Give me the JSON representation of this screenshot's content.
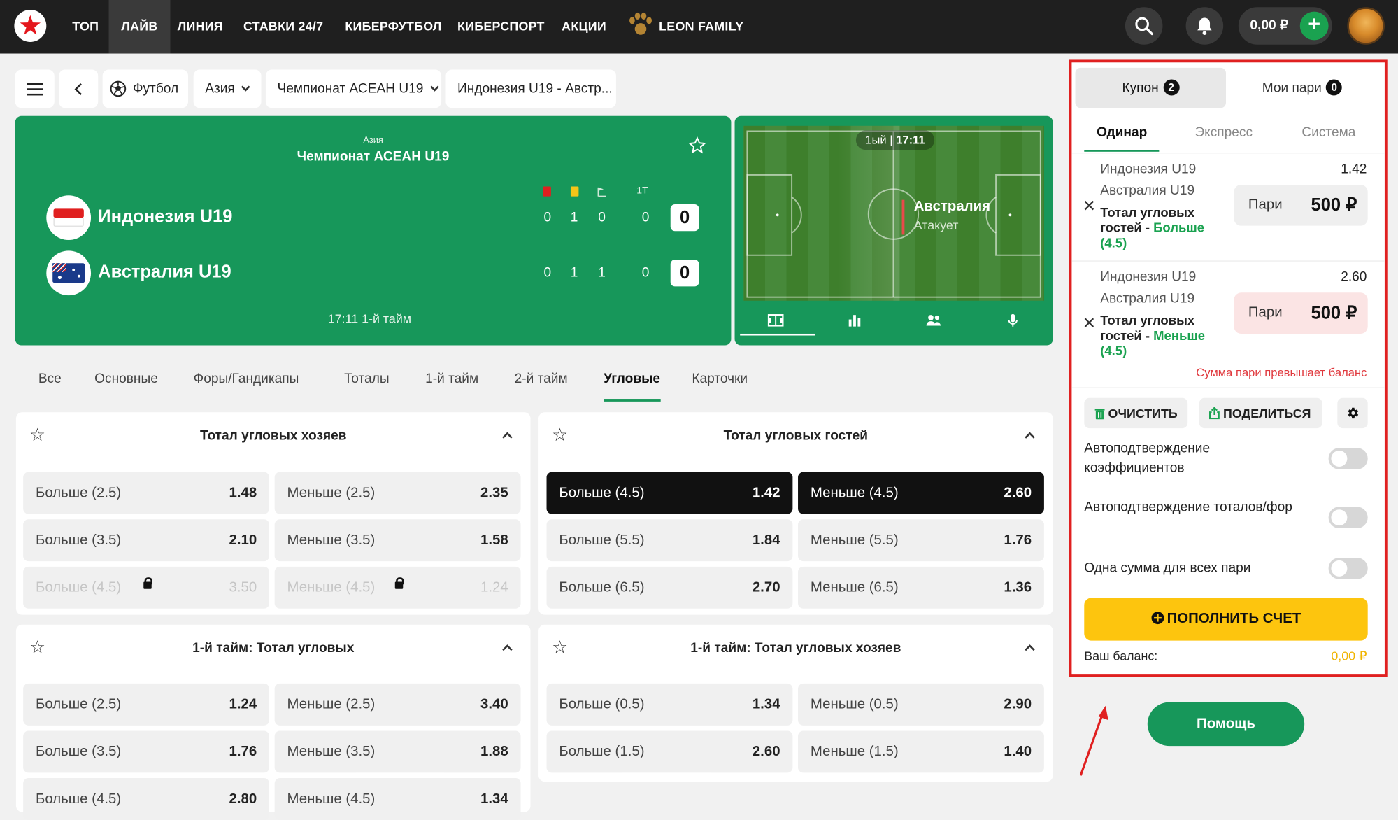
{
  "nav": {
    "items": [
      "ТОП",
      "ЛАЙВ",
      "ЛИНИЯ",
      "СТАВКИ 24/7",
      "КИБЕРФУТБОЛ",
      "КИБЕРСПОРТ",
      "АКЦИИ",
      "LEON FAMILY"
    ],
    "active": "ЛАЙВ",
    "balance": "0,00 ₽",
    "plus": "+"
  },
  "breadcrumb": {
    "sport": "Футбол",
    "region": "Азия",
    "league": "Чемпионат АСЕАН U19",
    "match": "Индонезия U19 - Австр..."
  },
  "match": {
    "region": "Азия",
    "league": "Чемпионат АСЕАН U19",
    "stat_header_1t": "1Т",
    "home": {
      "name": "Индонезия U19",
      "red": "0",
      "yellow": "1",
      "corners": "0",
      "first_half": "0",
      "score": "0"
    },
    "away": {
      "name": "Австралия U19",
      "red": "0",
      "yellow": "1",
      "corners": "1",
      "first_half": "0",
      "score": "0"
    },
    "time": "17:11 1-й тайм"
  },
  "field": {
    "period": "1ый",
    "clock": "17:11",
    "team": "Австралия",
    "action": "Атакует"
  },
  "market_tabs": [
    "Все",
    "Основные",
    "Форы/Гандикапы",
    "Тоталы",
    "1-й тайм",
    "2-й тайм",
    "Угловые",
    "Карточки"
  ],
  "active_market_tab": "Угловые",
  "markets": [
    {
      "title": "Тотал угловых хозяев",
      "rows": [
        [
          {
            "label": "Больше (2.5)",
            "odd": "1.48"
          },
          {
            "label": "Меньше (2.5)",
            "odd": "2.35"
          }
        ],
        [
          {
            "label": "Больше (3.5)",
            "odd": "2.10"
          },
          {
            "label": "Меньше (3.5)",
            "odd": "1.58"
          }
        ],
        [
          {
            "label": "Больше (4.5)",
            "odd": "3.50",
            "locked": true
          },
          {
            "label": "Меньше (4.5)",
            "odd": "1.24",
            "locked": true
          }
        ]
      ]
    },
    {
      "title": "Тотал угловых гостей",
      "rows": [
        [
          {
            "label": "Больше (4.5)",
            "odd": "1.42",
            "selected": true
          },
          {
            "label": "Меньше (4.5)",
            "odd": "2.60",
            "selected": true
          }
        ],
        [
          {
            "label": "Больше (5.5)",
            "odd": "1.84"
          },
          {
            "label": "Меньше (5.5)",
            "odd": "1.76"
          }
        ],
        [
          {
            "label": "Больше (6.5)",
            "odd": "2.70"
          },
          {
            "label": "Меньше (6.5)",
            "odd": "1.36"
          }
        ]
      ]
    },
    {
      "title": "1-й тайм: Тотал угловых",
      "rows": [
        [
          {
            "label": "Больше (2.5)",
            "odd": "1.24"
          },
          {
            "label": "Меньше (2.5)",
            "odd": "3.40"
          }
        ],
        [
          {
            "label": "Больше (3.5)",
            "odd": "1.76"
          },
          {
            "label": "Меньше (3.5)",
            "odd": "1.88"
          }
        ],
        [
          {
            "label": "Больше (4.5)",
            "odd": "2.80"
          },
          {
            "label": "Меньше (4.5)",
            "odd": "1.34"
          }
        ]
      ]
    },
    {
      "title": "1-й тайм: Тотал угловых хозяев",
      "rows": [
        [
          {
            "label": "Больше (0.5)",
            "odd": "1.34"
          },
          {
            "label": "Меньше (0.5)",
            "odd": "2.90"
          }
        ],
        [
          {
            "label": "Больше (1.5)",
            "odd": "2.60"
          },
          {
            "label": "Меньше (1.5)",
            "odd": "1.40"
          }
        ]
      ]
    }
  ],
  "coupon": {
    "tab_coupon": "Купон",
    "coupon_count": "2",
    "tab_my_bets": "Мои пари",
    "my_bets_count": "0",
    "bet_types": [
      "Одинар",
      "Экспресс",
      "Система"
    ],
    "active_bet_type": "Одинар",
    "bets": [
      {
        "home": "Индонезия U19",
        "away": "Австралия U19",
        "odds": "1.42",
        "market": "Тотал угловых гостей - ",
        "outcome": "Больше",
        "line": "(4.5)",
        "stake_label": "Пари",
        "stake": "500 ₽"
      },
      {
        "home": "Индонезия U19",
        "away": "Австралия U19",
        "odds": "2.60",
        "market": "Тотал угловых гостей - ",
        "outcome": "Меньше",
        "line": "(4.5)",
        "stake_label": "Пари",
        "stake": "500 ₽"
      }
    ],
    "warning": "Сумма пари превышает баланс",
    "clear": "ОЧИСТИТЬ",
    "share": "ПОДЕЛИТЬСЯ",
    "options": [
      "Автоподтверждение коэффициентов",
      "Автоподтверждение тоталов/фор",
      "Одна сумма для всех пари"
    ],
    "deposit": "ПОПОЛНИТЬ СЧЕТ",
    "balance_label": "Ваш баланс:",
    "balance_value": "0,00 ₽"
  },
  "help": "Помощь",
  "colors": {
    "brand_green": "#17975a",
    "accent_green": "#1aa250",
    "deposit_yellow": "#fdc50e",
    "topbar": "#1f1f1f",
    "highlight_red": "#e02020"
  }
}
